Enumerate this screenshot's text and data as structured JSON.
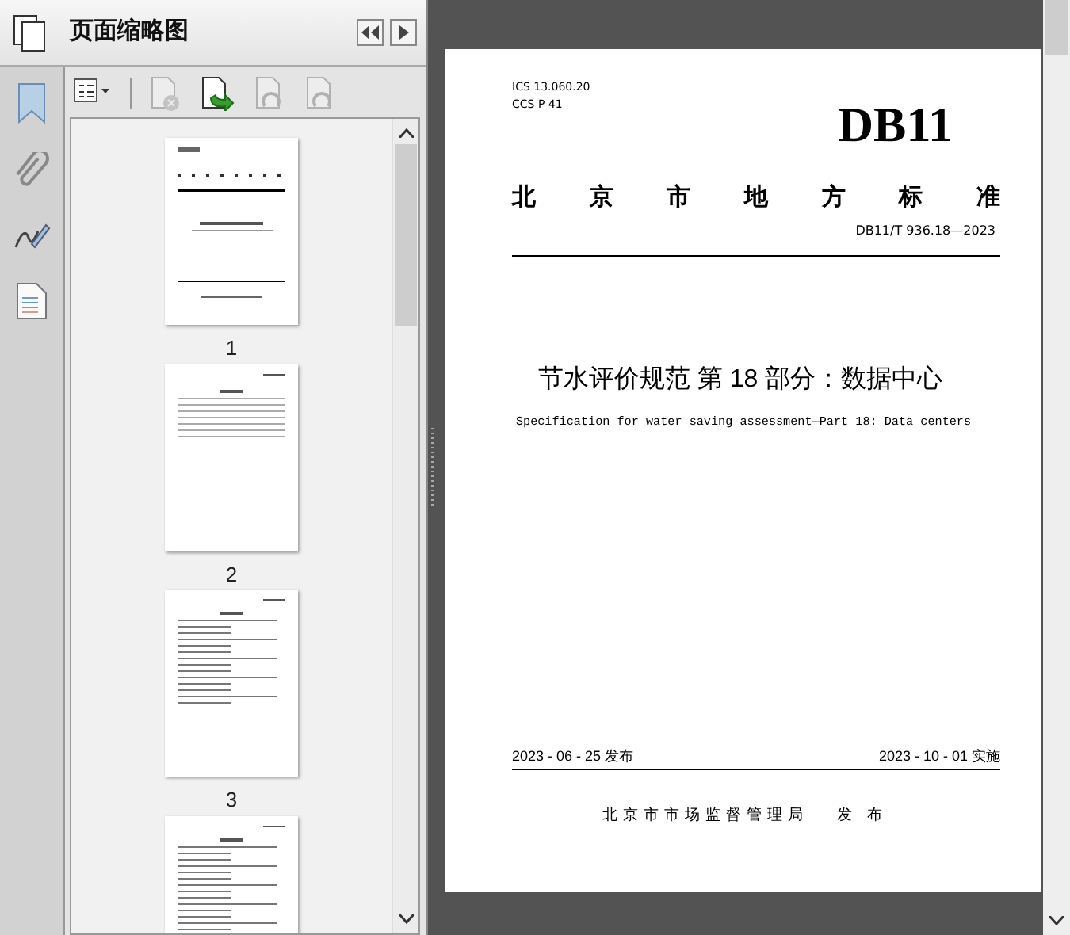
{
  "panel": {
    "title": "页面缩略图",
    "toolbar": [
      {
        "kind": "options",
        "disabled": false
      },
      {
        "kind": "delete",
        "disabled": true
      },
      {
        "kind": "insert",
        "disabled": false
      },
      {
        "kind": "rotate-left",
        "disabled": true
      },
      {
        "kind": "rotate-right",
        "disabled": true
      }
    ],
    "thumbnails": [
      {
        "label": "1",
        "kind": "cover"
      },
      {
        "label": "2",
        "kind": "contents"
      },
      {
        "label": "3",
        "kind": "text"
      },
      {
        "kind": "text"
      }
    ]
  },
  "document": {
    "ics": "ICS  13.060.20",
    "ccs": "CCS  P 41",
    "code": "DB11",
    "authority": "北京市地方标准",
    "standard_number": "DB11/T 936.18—2023",
    "title": "节水评价规范 第 18 部分：数据中心",
    "subtitle": "Specification for water saving assessment—Part 18: Data centers",
    "issued": "2023 - 06 - 25 发布",
    "effective": "2023 - 10 - 01 实施",
    "publisher": "北京市市场监督管理局",
    "publish_label": "发 布"
  }
}
